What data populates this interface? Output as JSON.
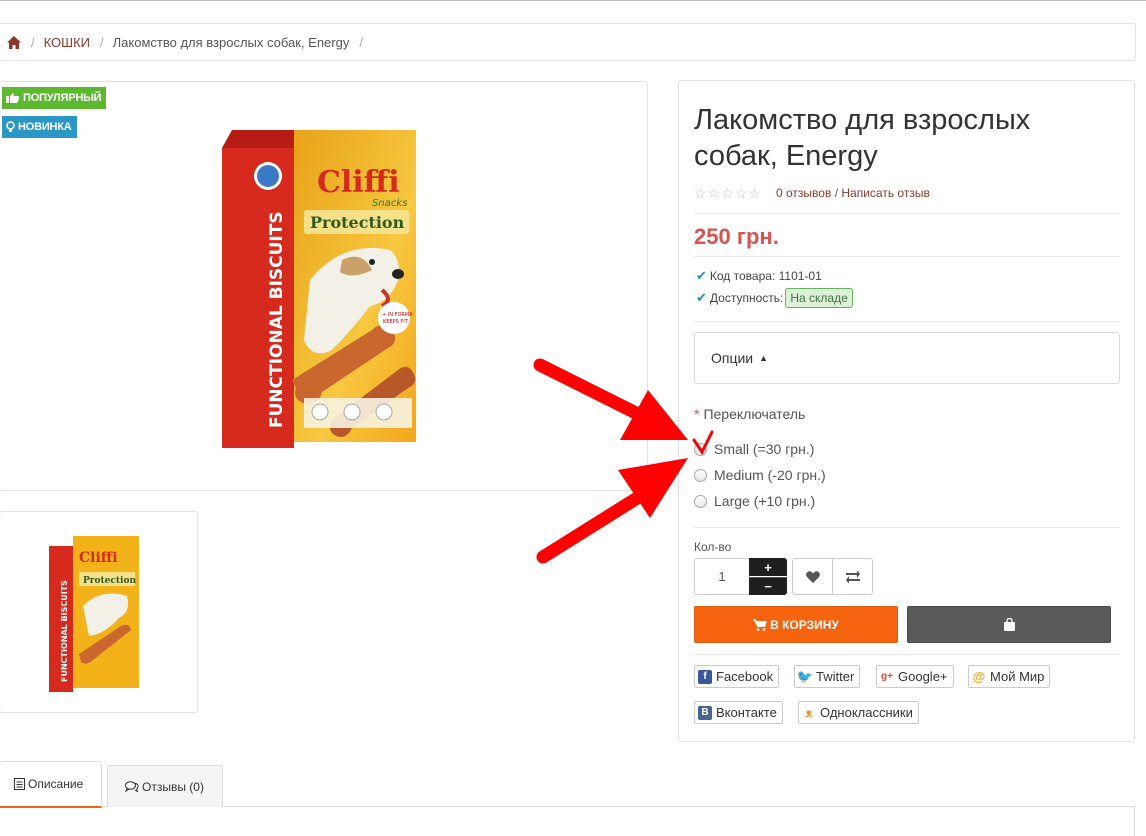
{
  "breadcrumb": {
    "home_icon": "home-icon",
    "items": [
      "КОШКИ",
      "Лакомство для взрослых собак, Energy"
    ]
  },
  "badges": {
    "popular": "ПОПУЛЯРНЫЙ",
    "new": "НОВИНКА"
  },
  "product": {
    "title": "Лакомство для взрослых собак, Energy",
    "image_text": {
      "brand": "Cliffi",
      "sub_brand": "Snacks",
      "name": "Protection",
      "side": "FUNCTIONAL BISCUITS",
      "sticker": "+ IN FORMA KEEPS FIT"
    },
    "reviews_link": "0 отзывов",
    "review_separator": "/",
    "write_review_link": "Написать отзыв",
    "rating": 0,
    "rating_max": 5,
    "price": "250 грн.",
    "code_label": "Код товара:",
    "code_value": "1101-01",
    "availability_label": "Доступность:",
    "availability_value": "На складе"
  },
  "options": {
    "title": "Опции",
    "switch_label": "Переключатель",
    "required_mark": "*",
    "choices": [
      "Small (=30 грн.)",
      "Medium (-20 грн.)",
      "Large (+10 грн.)"
    ]
  },
  "quantity": {
    "label": "Кол-во",
    "value": "1",
    "plus": "+",
    "minus": "−"
  },
  "buttons": {
    "cart": "В КОРЗИНУ"
  },
  "share": {
    "facebook": "Facebook",
    "twitter": "Twitter",
    "google": "Google+",
    "mymir": "Мой Мир",
    "vk": "Вконтакте",
    "ok": "Одноклассники"
  },
  "tabs": {
    "description": "Описание",
    "reviews": "Отзывы (0)"
  },
  "colors": {
    "accent": "#f7640f",
    "price": "#d9534f",
    "annotation": "#ff0000"
  }
}
